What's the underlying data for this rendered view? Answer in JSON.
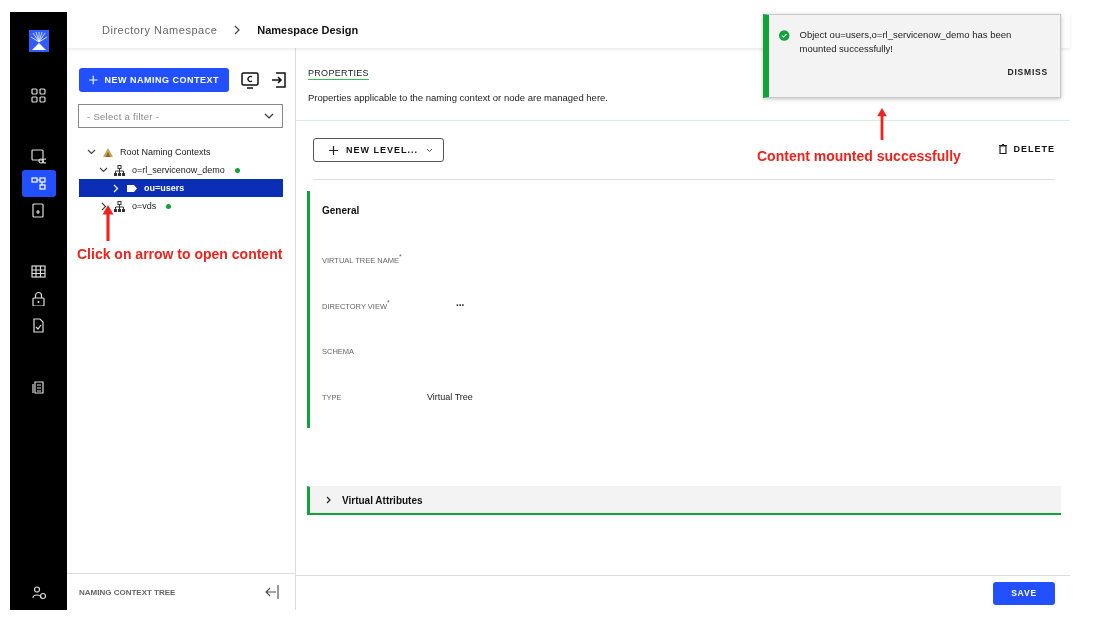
{
  "rail": {
    "items": [
      {
        "selected": false
      },
      {
        "selected": false
      },
      {
        "selected": true
      },
      {
        "selected": false
      },
      {
        "selected": false
      },
      {
        "selected": false
      },
      {
        "selected": false
      },
      {
        "selected": false
      }
    ]
  },
  "breadcrumb": [
    {
      "label": "Directory Namespace",
      "current": false
    },
    {
      "label": "Namespace Design",
      "current": true
    }
  ],
  "left_panel": {
    "new_button": "NEW NAMING CONTEXT",
    "filter": {
      "placeholder": "- Select a filter -"
    },
    "tree": [
      {
        "label": "Root Naming Contexts",
        "kind": "root",
        "expanded": true,
        "selected": false,
        "children": [
          {
            "label": "o=rl_servicenow_demo",
            "kind": "org",
            "expanded": true,
            "selected": false,
            "color": "#12a23a",
            "children": [
              {
                "label": "ou=users",
                "kind": "ou",
                "expanded": false,
                "selected": true
              }
            ]
          },
          {
            "label": "o=vds",
            "kind": "org",
            "expanded": false,
            "selected": false,
            "color": "#12a23a"
          }
        ]
      }
    ],
    "footer": "NAMING CONTEXT TREE"
  },
  "properties": {
    "tab": "PROPERTIES",
    "description": "Properties applicable to the naming context or node are managed here."
  },
  "toolbar": {
    "new_level": "NEW LEVEL...",
    "delete": "DELETE"
  },
  "general": {
    "title": "General",
    "fields": [
      {
        "label": "VIRTUAL TREE NAME",
        "required_mark": "*",
        "kind": "text"
      },
      {
        "label": "DIRECTORY VIEW",
        "required_mark": "*",
        "kind": "menu",
        "value": "..."
      },
      {
        "label": "SCHEMA",
        "kind": "text"
      },
      {
        "label": "TYPE",
        "kind": "text",
        "value": "Virtual Tree"
      }
    ]
  },
  "virtual_attributes": {
    "title": "Virtual Attributes",
    "expanded": false
  },
  "save": "SAVE",
  "toast": {
    "message": "Object ou=users,o=rl_servicenow_demo has been mounted successfully!",
    "action": "DISMISS"
  },
  "annotations": [
    {
      "kind": "left",
      "text": "Click on arrow to open content"
    },
    {
      "kind": "right",
      "text": "Content mounted successfully"
    }
  ]
}
